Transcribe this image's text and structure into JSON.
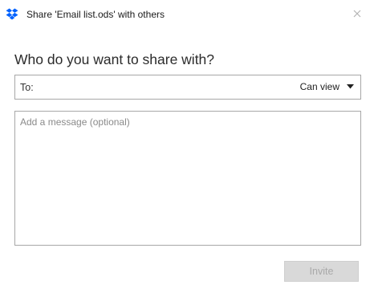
{
  "dialog": {
    "title": "Share 'Email list.ods' with others",
    "app_icon": "dropbox-icon",
    "close_icon": "close-icon"
  },
  "heading": "Who do you want to share with?",
  "to_field": {
    "label": "To:",
    "value": "",
    "placeholder": ""
  },
  "permission": {
    "selected": "Can view",
    "icon": "chevron-down-icon"
  },
  "message": {
    "value": "",
    "placeholder": "Add a message (optional)"
  },
  "actions": {
    "invite_label": "Invite",
    "invite_enabled": false
  },
  "colors": {
    "brand": "#0061FE",
    "border": "#A7A7A7",
    "button_disabled_bg": "#D9D9D9",
    "button_disabled_text": "#A9A9A9"
  }
}
